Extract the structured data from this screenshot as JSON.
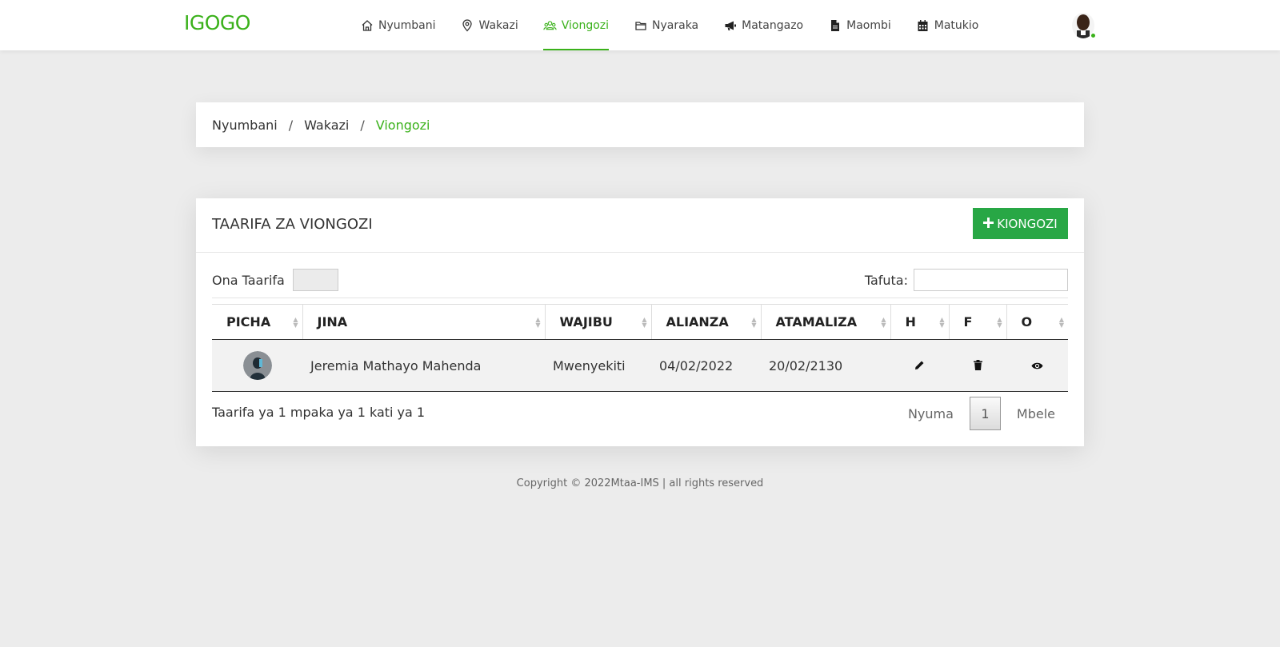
{
  "brand": "IGOGO",
  "nav": {
    "items": [
      {
        "label": "Nyumbani",
        "icon": "home-icon"
      },
      {
        "label": "Wakazi",
        "icon": "map-pin-icon"
      },
      {
        "label": "Viongozi",
        "icon": "users-icon",
        "active": true
      },
      {
        "label": "Nyaraka",
        "icon": "folder-icon"
      },
      {
        "label": "Matangazo",
        "icon": "megaphone-icon"
      },
      {
        "label": "Maombi",
        "icon": "file-icon"
      },
      {
        "label": "Matukio",
        "icon": "calendar-icon"
      }
    ]
  },
  "breadcrumb": {
    "items": [
      "Nyumbani",
      "Wakazi",
      "Viongozi"
    ],
    "separator": "/"
  },
  "card": {
    "title": "TAARIFA ZA VIONGOZI",
    "add_button": "KIONGOZI",
    "show_label": "Ona Taarifa",
    "search_label": "Tafuta:",
    "search_value": ""
  },
  "table": {
    "headers": [
      "PICHA",
      "JINA",
      "WAJIBU",
      "ALIANZA",
      "ATAMALIZA",
      "H",
      "F",
      "O"
    ],
    "rows": [
      {
        "name": "Jeremia Mathayo Mahenda",
        "role": "Mwenyekiti",
        "start": "04/02/2022",
        "end": "20/02/2130",
        "actions": [
          "edit-icon",
          "trash-icon",
          "eye-icon"
        ]
      }
    ]
  },
  "info_text": "Taarifa ya 1 mpaka ya 1 kati ya 1",
  "pagination": {
    "prev": "Nyuma",
    "current": "1",
    "next": "Mbele"
  },
  "footer": "Copyright © 2022Mtaa-IMS | all rights reserved",
  "colors": {
    "accent": "#3ab11a",
    "button": "#28a745",
    "background": "#ececec"
  }
}
